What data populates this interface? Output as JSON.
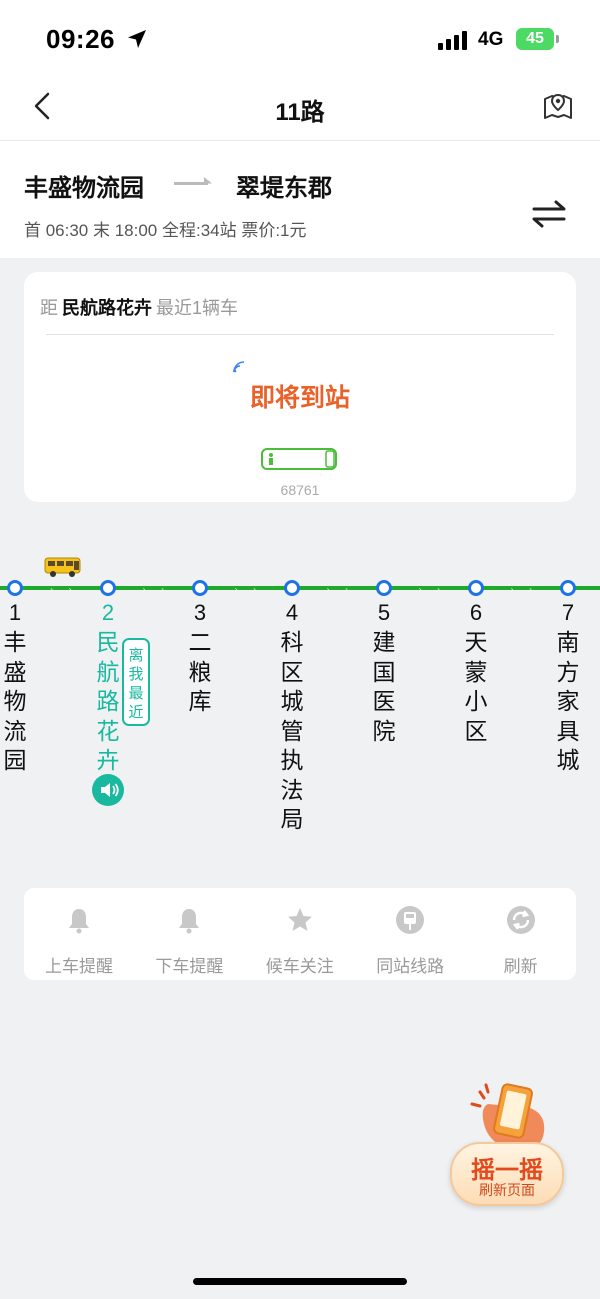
{
  "status_bar": {
    "time": "09:26",
    "network": "4G",
    "battery": "45"
  },
  "nav": {
    "title": "11路"
  },
  "route": {
    "from": "丰盛物流园",
    "to": "翠堤东郡",
    "info": "首 06:30 末 18:00 全程:34站  票价:1元"
  },
  "arrival_card": {
    "prefix": "距",
    "station": "民航路花卉",
    "suffix": "最近1辆车",
    "status": "即将到站",
    "bus_id": "68761"
  },
  "stops": [
    {
      "num": "1",
      "name": "丰盛物流园"
    },
    {
      "num": "2",
      "name": "民航路花卉"
    },
    {
      "num": "3",
      "name": "二粮库"
    },
    {
      "num": "4",
      "name": "科区城管执法局"
    },
    {
      "num": "5",
      "name": "建国医院"
    },
    {
      "num": "6",
      "name": "天蒙小区"
    },
    {
      "num": "7",
      "name": "南方家具城"
    }
  ],
  "current_stop_index": 1,
  "near_badge": "离我最近",
  "actions": [
    {
      "label": "上车提醒",
      "icon": "bell-icon"
    },
    {
      "label": "下车提醒",
      "icon": "bell-icon"
    },
    {
      "label": "候车关注",
      "icon": "star-icon"
    },
    {
      "label": "同站线路",
      "icon": "bus-stop-icon"
    },
    {
      "label": "刷新",
      "icon": "refresh-icon"
    }
  ],
  "shake": {
    "title": "摇一摇",
    "subtitle": "刷新页面"
  },
  "colors": {
    "accent_green": "#1faa2b",
    "teal": "#19b9a0",
    "arrive_orange": "#e8622a",
    "stop_blue": "#1e73e6"
  }
}
